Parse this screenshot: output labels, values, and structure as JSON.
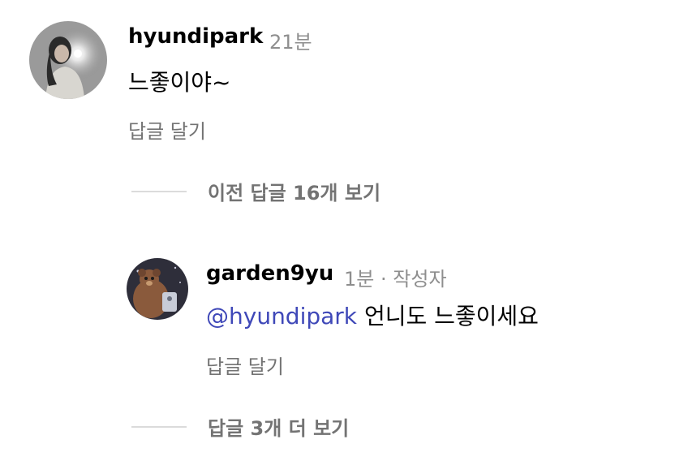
{
  "comment": {
    "username": "hyundipark",
    "time": "21분",
    "text": "느좋이야~",
    "reply_label": "답글 달기"
  },
  "view_previous": {
    "label": "이전 답글 16개 보기"
  },
  "reply": {
    "username": "garden9yu",
    "time": "1분",
    "separator": "·",
    "author_badge": "작성자",
    "mention": "@hyundipark",
    "text": "언니도 느좋이세요",
    "reply_label": "답글 달기"
  },
  "view_more": {
    "label": "답글 3개 더 보기"
  },
  "colors": {
    "mention": "#3f48b8",
    "muted": "#8e8e8e",
    "divider": "#dbdbdb"
  }
}
